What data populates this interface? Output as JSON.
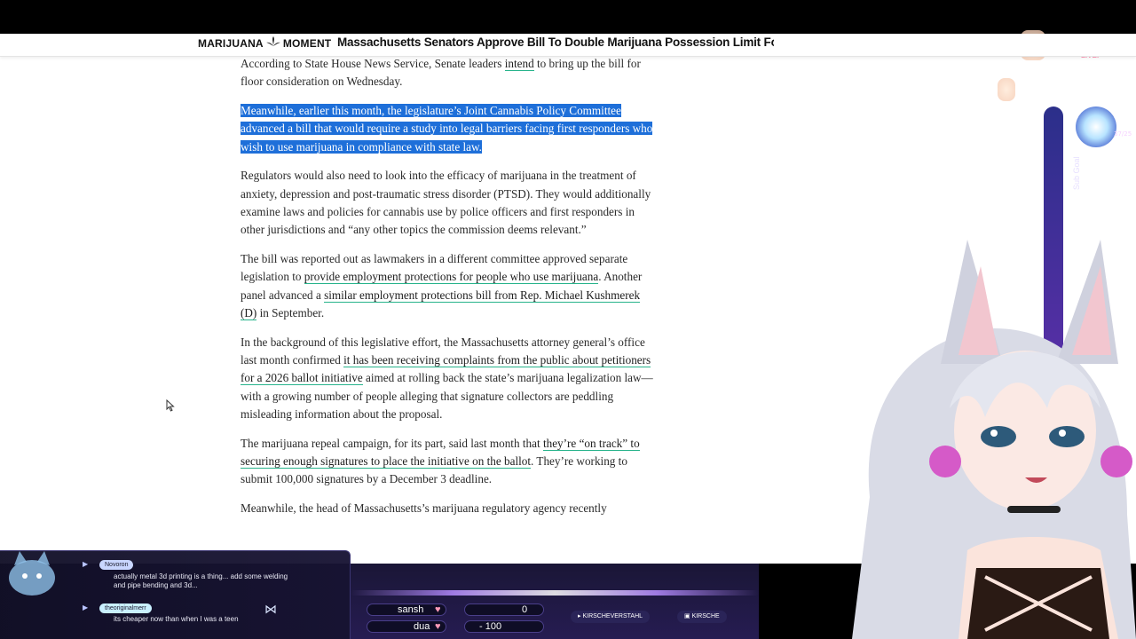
{
  "header": {
    "logo_left": "MARIJUANA",
    "logo_right": "MOMENT",
    "title": "Massachusetts Senators Approve Bill To Double Marijuana Possession Limit For Adults And"
  },
  "article": {
    "p1": {
      "t1": "According to State House News Service, Senate leaders ",
      "link1": "intend",
      "t2": " to bring up the bill for floor consideration on Wednesday."
    },
    "p2": {
      "t1": "Meanwhile, earlier this month, the legislature’s Joint Cannabis Policy Committee ",
      "link1": "advanced a bill",
      "t2": " that would require a study into legal barriers facing first responders who wish to use marijuana in compliance with state law."
    },
    "p3": {
      "t1": "Regulators would also need to look into the efficacy of marijuana in the treatment of anxiety, depression and post-traumatic stress disorder (PTSD). They would additionally examine laws and policies for cannabis use by police officers and first responders in other jurisdictions and “any other topics the commission deems relevant.”"
    },
    "p4": {
      "t1": "The bill was reported out as lawmakers in a different committee approved separate legislation to ",
      "link1": "provide employment protections for people who use marijuana",
      "t2": ". Another panel advanced a ",
      "link2": "similar employment protections bill from Rep. Michael Kushmerek (D)",
      "t3": " in September."
    },
    "p5": {
      "t1": "In the background of this legislative effort, the Massachusetts attorney general’s office last month confirmed ",
      "link1": "it has been receiving complaints from the public about petitioners for a 2026 ballot initiative",
      "t2": " aimed at rolling back the state’s marijuana legalization law—with a growing number of people alleging that signature collectors are peddling misleading information about the proposal."
    },
    "p6": {
      "t1": "The marijuana repeal campaign, for its part, said last month that ",
      "link1": "they’re “on track” to securing enough signatures to place the initiative on the ballot",
      "t2": ". They’re working to submit 100,000 signatures by a December 3 deadline."
    },
    "p7": {
      "t1": "Meanwhile, the head of Massachusetts’s marijuana regulatory agency recently"
    }
  },
  "overlay": {
    "live_label": "LIVE!",
    "goal_label": "Sub Goal",
    "goal_count": "37/25"
  },
  "chat": {
    "messages": [
      {
        "user": "Novoron",
        "text": "actually metal 3d printing is a thing... add some welding and pipe bending and 3d..."
      },
      {
        "user": "theoriginalmerr",
        "text": "its cheaper now than when I was a teen"
      }
    ]
  },
  "toolbar": {
    "player1_name": "sansh",
    "player1_value": "0",
    "player2_name": "dua",
    "player2_value": "- 100",
    "btn1": "KIRSCHEVERSTAHL",
    "btn2": "KIRSCHE"
  },
  "colors": {
    "link_underline": "#27b38b",
    "selection": "#1e6fd9",
    "overlay_bg": "#1a1636"
  },
  "icons": [
    "leaf-logo-icon",
    "cursor-icon",
    "play-arrow-icon",
    "twitter-icon",
    "chat-icon",
    "heart-icon"
  ]
}
